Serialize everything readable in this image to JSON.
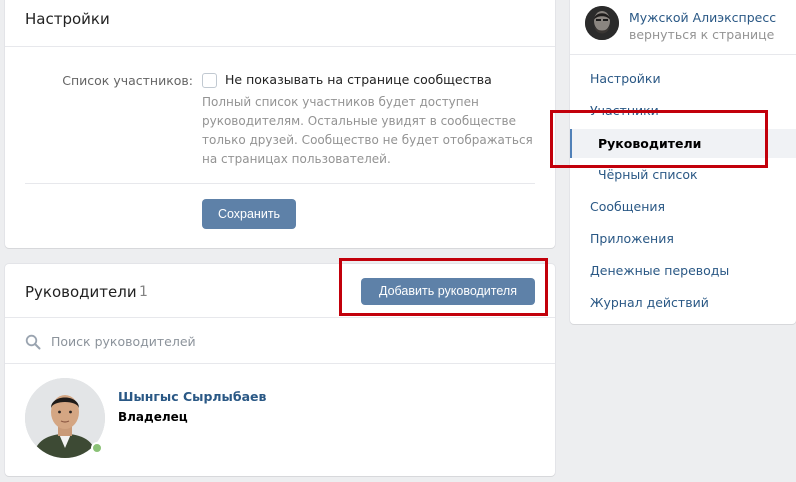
{
  "settings": {
    "title": "Настройки",
    "members_label": "Список участников:",
    "hide_checkbox_label": "Не показывать на странице сообщества",
    "hide_hint": "Полный список участников будет доступен руководителям. Остальные увидят в сообществе только друзей. Сообщество не будет отображаться на страницах пользователей.",
    "save_label": "Сохранить"
  },
  "managers": {
    "title": "Руководители",
    "count": "1",
    "add_button_label": "Добавить руководителя",
    "search_placeholder": "Поиск руководителей",
    "items": [
      {
        "name": "Шынгыс Сырлыбаев",
        "role": "Владелец",
        "online": true
      }
    ]
  },
  "sidebar": {
    "group_name": "Мужской Алиэкспресс",
    "back_link": "вернуться к странице",
    "items": [
      {
        "label": "Настройки"
      },
      {
        "label": "Участники"
      },
      {
        "label": "Руководители",
        "sub": true,
        "active": true
      },
      {
        "label": "Чёрный список",
        "sub": true
      },
      {
        "label": "Сообщения"
      },
      {
        "label": "Приложения"
      },
      {
        "label": "Денежные переводы"
      },
      {
        "label": "Журнал действий"
      }
    ]
  },
  "colors": {
    "accent": "#5e81a8",
    "link": "#2a5885",
    "highlight": "#c2000b",
    "online": "#8ac176"
  }
}
